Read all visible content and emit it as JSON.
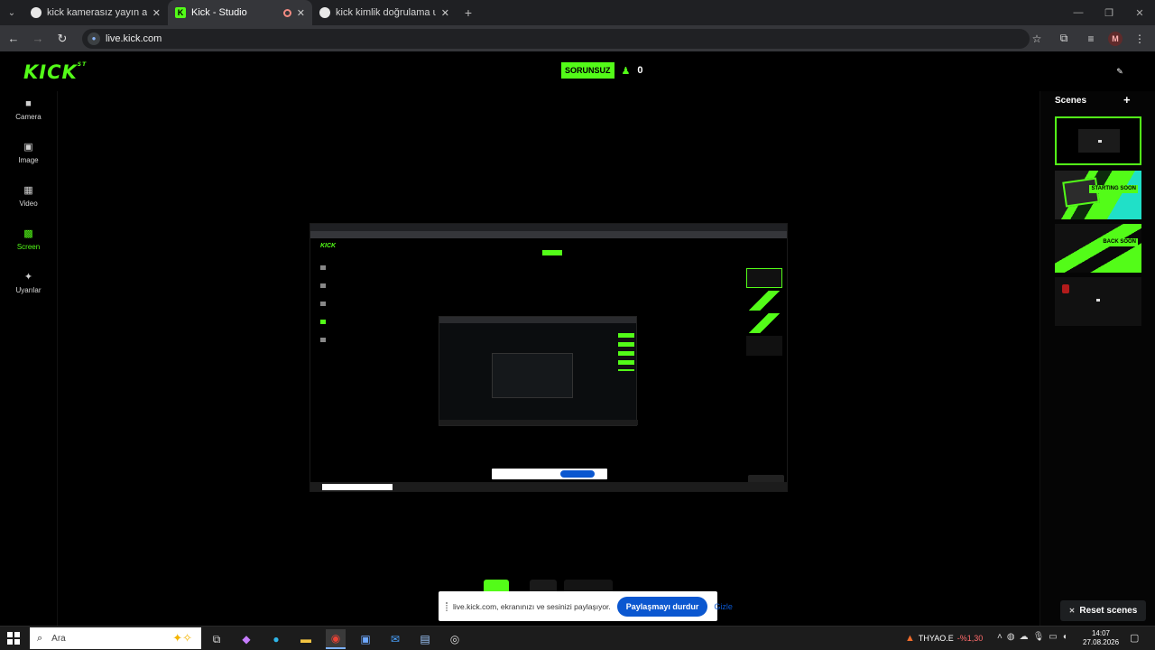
{
  "browser": {
    "tabs": [
      {
        "title": "kick kamerasız yayın açma - Go",
        "active": false
      },
      {
        "title": "Kick - Studio",
        "active": true
      },
      {
        "title": "kick kimlik doğrulama uygulama",
        "active": false
      }
    ],
    "url": "live.kick.com",
    "profile_initial": "M"
  },
  "header": {
    "logo": "KICK",
    "logo_sup": "ST",
    "status": "SORUNSUZ",
    "viewers": "0"
  },
  "sidebar": {
    "items": [
      {
        "label": "Camera",
        "icon": "camera-icon"
      },
      {
        "label": "Image",
        "icon": "image-icon"
      },
      {
        "label": "Video",
        "icon": "video-icon"
      },
      {
        "label": "Screen",
        "icon": "screen-icon",
        "active": true
      },
      {
        "label": "Uyarılar",
        "icon": "alerts-icon"
      }
    ]
  },
  "scenes": {
    "title": "Scenes",
    "items": [
      {
        "name": "scene-1",
        "selected": true
      },
      {
        "name": "scene-starting-soon",
        "label": "STARTING SOON"
      },
      {
        "name": "scene-back-soon",
        "label": "BACK SOON"
      },
      {
        "name": "scene-4"
      }
    ],
    "reset_label": "Reset scenes"
  },
  "share_notice": {
    "message": "live.kick.com, ekranınızı ve sesinizi paylaşıyor.",
    "stop_label": "Paylaşmayı durdur",
    "hide_label": "Gizle"
  },
  "taskbar": {
    "search_placeholder": "Ara",
    "stock_symbol": "THYAO.E",
    "stock_change": "-%1,30",
    "time": "14:07",
    "date": "27.08.2026"
  },
  "colors": {
    "accent": "#53fc18",
    "browser_dark": "#35363a",
    "share_blue": "#0b57d0"
  }
}
